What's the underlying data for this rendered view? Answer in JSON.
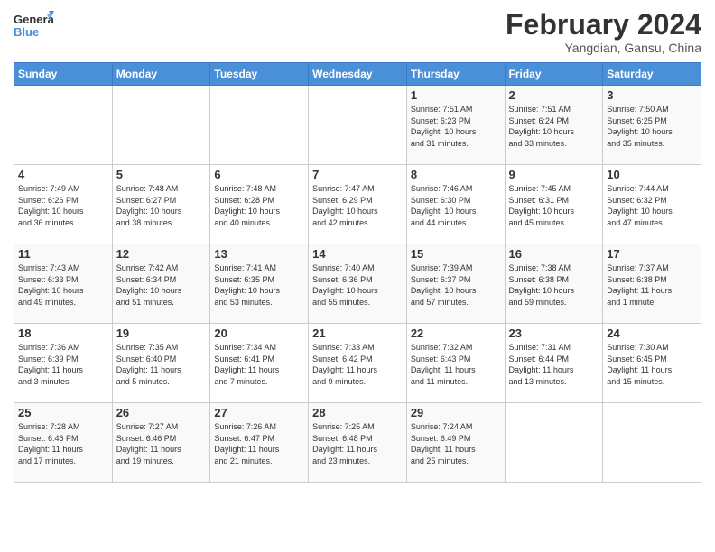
{
  "logo": {
    "text_general": "General",
    "text_blue": "Blue"
  },
  "header": {
    "month_year": "February 2024",
    "location": "Yangdian, Gansu, China"
  },
  "weekdays": [
    "Sunday",
    "Monday",
    "Tuesday",
    "Wednesday",
    "Thursday",
    "Friday",
    "Saturday"
  ],
  "weeks": [
    [
      {
        "day": "",
        "info": ""
      },
      {
        "day": "",
        "info": ""
      },
      {
        "day": "",
        "info": ""
      },
      {
        "day": "",
        "info": ""
      },
      {
        "day": "1",
        "info": "Sunrise: 7:51 AM\nSunset: 6:23 PM\nDaylight: 10 hours\nand 31 minutes."
      },
      {
        "day": "2",
        "info": "Sunrise: 7:51 AM\nSunset: 6:24 PM\nDaylight: 10 hours\nand 33 minutes."
      },
      {
        "day": "3",
        "info": "Sunrise: 7:50 AM\nSunset: 6:25 PM\nDaylight: 10 hours\nand 35 minutes."
      }
    ],
    [
      {
        "day": "4",
        "info": "Sunrise: 7:49 AM\nSunset: 6:26 PM\nDaylight: 10 hours\nand 36 minutes."
      },
      {
        "day": "5",
        "info": "Sunrise: 7:48 AM\nSunset: 6:27 PM\nDaylight: 10 hours\nand 38 minutes."
      },
      {
        "day": "6",
        "info": "Sunrise: 7:48 AM\nSunset: 6:28 PM\nDaylight: 10 hours\nand 40 minutes."
      },
      {
        "day": "7",
        "info": "Sunrise: 7:47 AM\nSunset: 6:29 PM\nDaylight: 10 hours\nand 42 minutes."
      },
      {
        "day": "8",
        "info": "Sunrise: 7:46 AM\nSunset: 6:30 PM\nDaylight: 10 hours\nand 44 minutes."
      },
      {
        "day": "9",
        "info": "Sunrise: 7:45 AM\nSunset: 6:31 PM\nDaylight: 10 hours\nand 45 minutes."
      },
      {
        "day": "10",
        "info": "Sunrise: 7:44 AM\nSunset: 6:32 PM\nDaylight: 10 hours\nand 47 minutes."
      }
    ],
    [
      {
        "day": "11",
        "info": "Sunrise: 7:43 AM\nSunset: 6:33 PM\nDaylight: 10 hours\nand 49 minutes."
      },
      {
        "day": "12",
        "info": "Sunrise: 7:42 AM\nSunset: 6:34 PM\nDaylight: 10 hours\nand 51 minutes."
      },
      {
        "day": "13",
        "info": "Sunrise: 7:41 AM\nSunset: 6:35 PM\nDaylight: 10 hours\nand 53 minutes."
      },
      {
        "day": "14",
        "info": "Sunrise: 7:40 AM\nSunset: 6:36 PM\nDaylight: 10 hours\nand 55 minutes."
      },
      {
        "day": "15",
        "info": "Sunrise: 7:39 AM\nSunset: 6:37 PM\nDaylight: 10 hours\nand 57 minutes."
      },
      {
        "day": "16",
        "info": "Sunrise: 7:38 AM\nSunset: 6:38 PM\nDaylight: 10 hours\nand 59 minutes."
      },
      {
        "day": "17",
        "info": "Sunrise: 7:37 AM\nSunset: 6:38 PM\nDaylight: 11 hours\nand 1 minute."
      }
    ],
    [
      {
        "day": "18",
        "info": "Sunrise: 7:36 AM\nSunset: 6:39 PM\nDaylight: 11 hours\nand 3 minutes."
      },
      {
        "day": "19",
        "info": "Sunrise: 7:35 AM\nSunset: 6:40 PM\nDaylight: 11 hours\nand 5 minutes."
      },
      {
        "day": "20",
        "info": "Sunrise: 7:34 AM\nSunset: 6:41 PM\nDaylight: 11 hours\nand 7 minutes."
      },
      {
        "day": "21",
        "info": "Sunrise: 7:33 AM\nSunset: 6:42 PM\nDaylight: 11 hours\nand 9 minutes."
      },
      {
        "day": "22",
        "info": "Sunrise: 7:32 AM\nSunset: 6:43 PM\nDaylight: 11 hours\nand 11 minutes."
      },
      {
        "day": "23",
        "info": "Sunrise: 7:31 AM\nSunset: 6:44 PM\nDaylight: 11 hours\nand 13 minutes."
      },
      {
        "day": "24",
        "info": "Sunrise: 7:30 AM\nSunset: 6:45 PM\nDaylight: 11 hours\nand 15 minutes."
      }
    ],
    [
      {
        "day": "25",
        "info": "Sunrise: 7:28 AM\nSunset: 6:46 PM\nDaylight: 11 hours\nand 17 minutes."
      },
      {
        "day": "26",
        "info": "Sunrise: 7:27 AM\nSunset: 6:46 PM\nDaylight: 11 hours\nand 19 minutes."
      },
      {
        "day": "27",
        "info": "Sunrise: 7:26 AM\nSunset: 6:47 PM\nDaylight: 11 hours\nand 21 minutes."
      },
      {
        "day": "28",
        "info": "Sunrise: 7:25 AM\nSunset: 6:48 PM\nDaylight: 11 hours\nand 23 minutes."
      },
      {
        "day": "29",
        "info": "Sunrise: 7:24 AM\nSunset: 6:49 PM\nDaylight: 11 hours\nand 25 minutes."
      },
      {
        "day": "",
        "info": ""
      },
      {
        "day": "",
        "info": ""
      }
    ]
  ]
}
